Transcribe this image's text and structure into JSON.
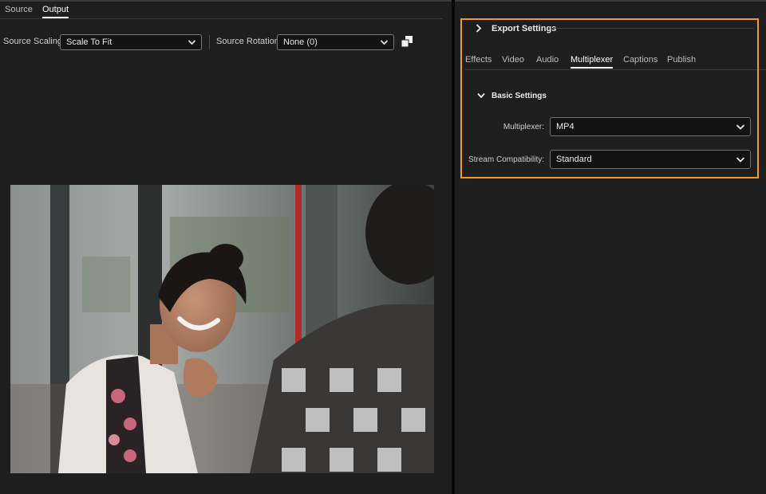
{
  "left": {
    "tabs": [
      {
        "label": "Source",
        "active": false
      },
      {
        "label": "Output",
        "active": true
      }
    ],
    "source_scaling": {
      "label": "Source Scaling:",
      "value": "Scale To Fit"
    },
    "source_rotation": {
      "label": "Source Rotation:",
      "value": "None (0)"
    },
    "crop_icon": "crop-icon"
  },
  "right": {
    "export_settings_title": "Export Settings",
    "tabs": [
      {
        "label": "Effects",
        "active": false
      },
      {
        "label": "Video",
        "active": false
      },
      {
        "label": "Audio",
        "active": false
      },
      {
        "label": "Multiplexer",
        "active": true
      },
      {
        "label": "Captions",
        "active": false
      },
      {
        "label": "Publish",
        "active": false
      }
    ],
    "basic_settings_title": "Basic Settings",
    "multiplexer": {
      "label": "Multiplexer:",
      "value": "MP4"
    },
    "stream_compat": {
      "label": "Stream Compatibility:",
      "value": "Standard"
    }
  },
  "colors": {
    "highlight": "#f09a2a",
    "panel_bg": "#1e1e1e",
    "active_tab": "#ffffff"
  }
}
